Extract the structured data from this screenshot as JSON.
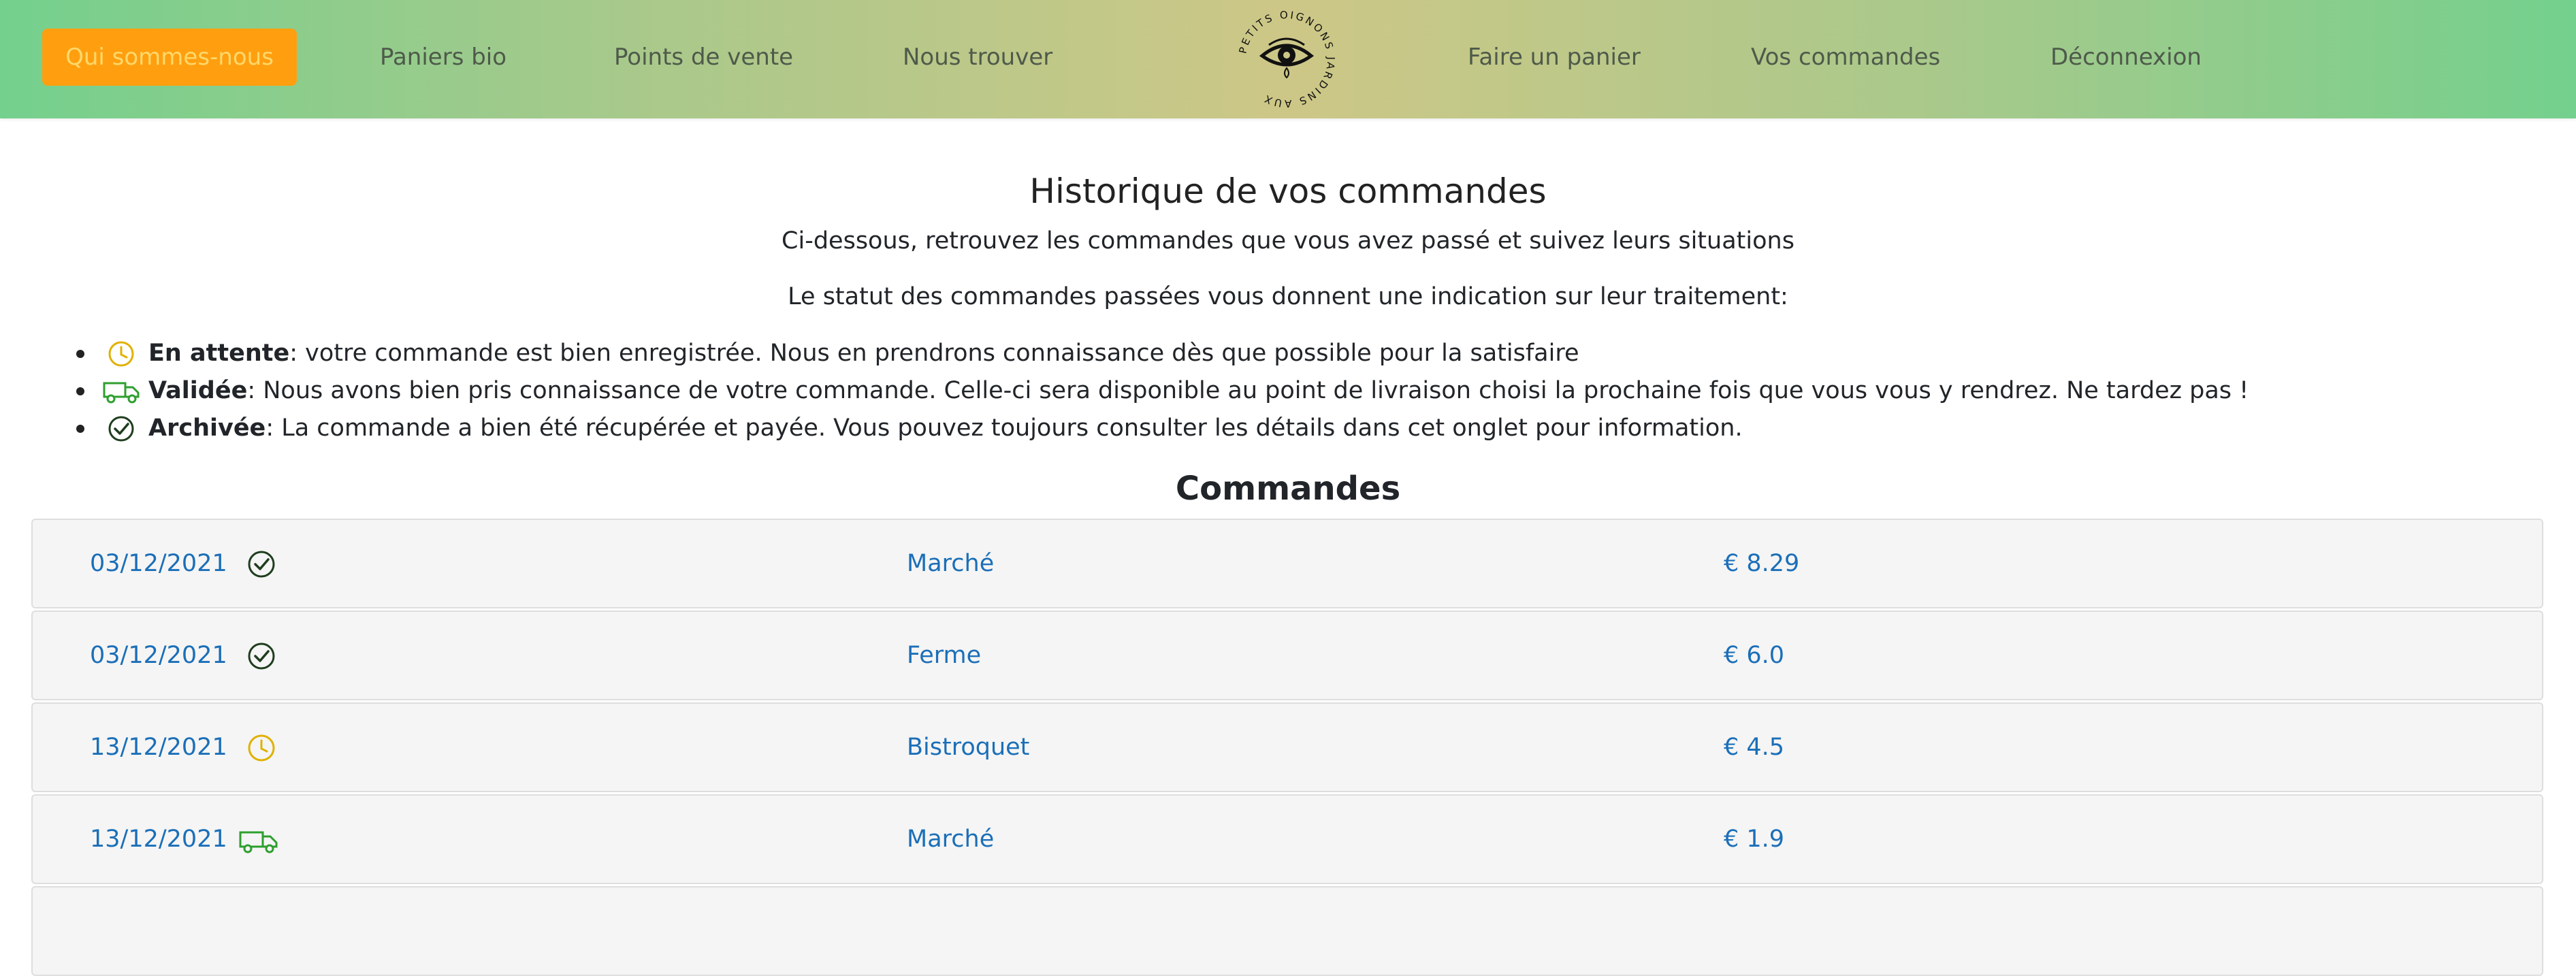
{
  "nav": {
    "items": [
      {
        "label": "Qui sommes-nous",
        "active": true
      },
      {
        "label": "Paniers bio",
        "active": false
      },
      {
        "label": "Points de vente",
        "active": false
      },
      {
        "label": "Nous trouver",
        "active": false
      },
      {
        "label": "Faire un panier",
        "active": false
      },
      {
        "label": "Vos commandes",
        "active": false
      },
      {
        "label": "Déconnexion",
        "active": false
      }
    ],
    "logo_text": "PETITS OIGNONS JARDINS AUX"
  },
  "page": {
    "title": "Historique de vos commandes",
    "subtitle": "Ci-dessous, retrouvez les commandes que vous avez passé et suivez leurs situations",
    "status_intro": "Le statut des commandes passées vous donnent une indication sur leur traitement:"
  },
  "statuses": [
    {
      "name": "En attente",
      "icon": "clock-icon",
      "color": "#e0b100",
      "description": ": votre commande est bien enregistrée. Nous en prendrons connaissance dès que possible pour la satisfaire"
    },
    {
      "name": "Validée",
      "icon": "truck-icon",
      "color": "#2e9f2e",
      "description": ": Nous avons bien pris connaissance de votre commande. Celle-ci sera disponible au point de livraison choisi la prochaine fois que vous vous y rendrez. Ne tardez pas !"
    },
    {
      "name": "Archivée",
      "icon": "check-circle-icon",
      "color": "#1f3d1f",
      "description": ": La commande a bien été récupérée et payée. Vous pouvez toujours consulter les détails dans cet onglet pour information."
    }
  ],
  "orders_title": "Commandes",
  "orders": [
    {
      "date": "03/12/2021",
      "status_icon": "check-circle-icon",
      "place": "Marché",
      "price": "€ 8.29"
    },
    {
      "date": "03/12/2021",
      "status_icon": "check-circle-icon",
      "place": "Ferme",
      "price": "€ 6.0"
    },
    {
      "date": "13/12/2021",
      "status_icon": "clock-icon",
      "place": "Bistroquet",
      "price": "€ 4.5"
    },
    {
      "date": "13/12/2021",
      "status_icon": "truck-icon",
      "place": "Marché",
      "price": "€ 1.9"
    }
  ],
  "colors": {
    "link": "#1b6fb8",
    "active_nav_bg": "#ff9f0f",
    "active_nav_text": "#ffd86b",
    "nav_text": "#4e5a4a",
    "row_bg": "#f5f5f5"
  }
}
